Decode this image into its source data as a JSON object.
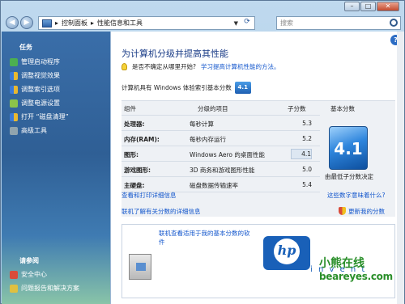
{
  "window": {
    "controls": [
      "–",
      "□",
      "✕"
    ]
  },
  "address_bar": {
    "segments": [
      "控制面板",
      "性能信息和工具"
    ],
    "separator": "▸"
  },
  "search": {
    "placeholder": "搜索"
  },
  "sidebar": {
    "tasks_header": "任务",
    "items": [
      {
        "label": "管理启动程序",
        "icon": "startup-icon",
        "color": "#4caf50"
      },
      {
        "label": "调整视觉效果",
        "icon": "shield-icon",
        "color": "#e8b830"
      },
      {
        "label": "调整索引选项",
        "icon": "shield-icon",
        "color": "#e8b830"
      },
      {
        "label": "调整电源设置",
        "icon": "power-icon",
        "color": "#8bc34a"
      },
      {
        "label": "打开 “磁盘清理”",
        "icon": "shield-icon",
        "color": "#e8b830"
      },
      {
        "label": "高级工具",
        "icon": "tools-icon",
        "color": "#90a4ae"
      }
    ],
    "see_also_header": "请参阅",
    "see_also": [
      {
        "label": "安全中心",
        "icon": "security-center-icon",
        "color": "#d94b3a"
      },
      {
        "label": "问题报告和解决方案",
        "icon": "problem-reports-icon",
        "color": "#e0c040"
      }
    ]
  },
  "main": {
    "title": "为计算机分级并提高其性能",
    "tip_text": "是否不确定从哪里开始?",
    "tip_link": "学习提高计算机性能的方法。",
    "rated_text": "计算机具有 Windows 体验索引基本分数",
    "rated_badge": "4.1",
    "table": {
      "headers": [
        "组件",
        "分级的项目",
        "子分数",
        "基本分数"
      ],
      "rows": [
        {
          "component": "处理器:",
          "item": "每秒计算",
          "score": "5.3"
        },
        {
          "component": "内存(RAM):",
          "item": "每秒内存运行",
          "score": "5.2"
        },
        {
          "component": "图形:",
          "item": "Windows Aero 的桌面性能",
          "score": "4.1"
        },
        {
          "component": "游戏图形:",
          "item": "3D 商务和游戏图形性能",
          "score": "5.0"
        },
        {
          "component": "主硬盘:",
          "item": "磁盘数据传输速率",
          "score": "5.4"
        }
      ],
      "base_score": "4.1",
      "base_note": "由最低子分数决定"
    },
    "links": {
      "view_print": "查看和打印详细信息",
      "what_mean": "这些数字意味着什么?",
      "learn_online": "联机了解有关分数的详细信息",
      "update": "更新我的分数"
    },
    "promo": {
      "text": "联机查看适用于我的基本分数的软件",
      "brand": "hp",
      "brand_suffix": "i n v e n t",
      "brand_color": "#1960b8"
    }
  },
  "watermark": {
    "cn": "小熊在线",
    "en": "beareyes.com"
  },
  "help_label": "?"
}
